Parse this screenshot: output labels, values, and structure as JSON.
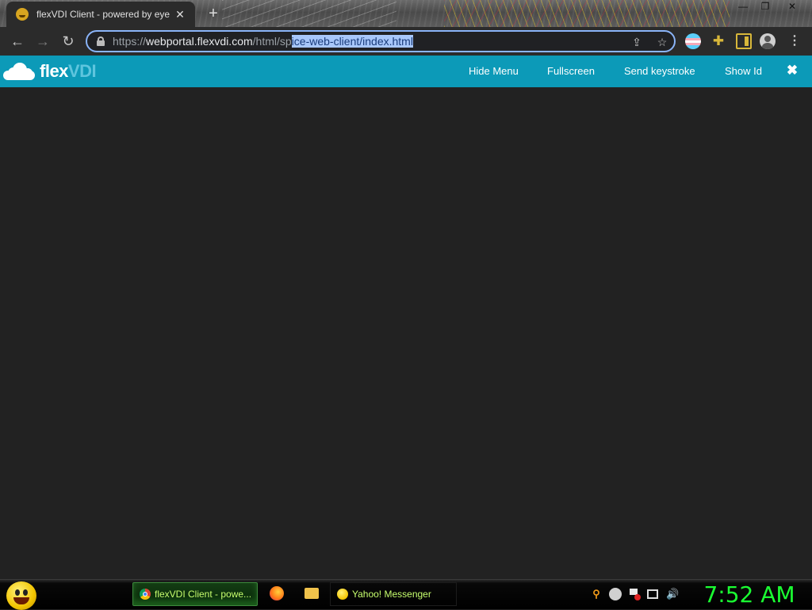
{
  "browser": {
    "tab_title": "flexVDI Client - powered by eye",
    "tab_close_glyph": "✕",
    "new_tab_glyph": "+",
    "window_controls": {
      "minimize": "—",
      "restore": "❐",
      "close": "✕"
    },
    "nav": {
      "back": "←",
      "forward": "→",
      "reload": "↻"
    },
    "url": {
      "scheme": "https://",
      "host": "webportal.flexvdi.com",
      "path_plain": "/html/sp",
      "path_selected": "ice-web-client/index.html"
    },
    "omnibox_icons": {
      "share": "⇪",
      "bookmark": "☆"
    },
    "extension_icons": [
      "profile-flag-icon",
      "puzzle-icon",
      "side-panel-icon",
      "account-avatar-icon",
      "kebab-menu-icon"
    ],
    "puzzle_glyph": "✚",
    "menu_glyph": "⋮"
  },
  "app": {
    "logo": {
      "part1": "flex",
      "part2": "VDI"
    },
    "menu": {
      "hide_menu": "Hide Menu",
      "fullscreen": "Fullscreen",
      "send_keystroke": "Send keystroke",
      "show_id": "Show Id"
    },
    "close_glyph": "✖",
    "colors": {
      "bar": "#0c9ab8",
      "canvas": "#222222"
    }
  },
  "taskbar": {
    "tasks": [
      {
        "label": "flexVDI Client - powe...",
        "icon": "chrome-icon",
        "active": true
      },
      {
        "label": "Yahoo! Messenger",
        "icon": "yahoo-messenger-icon",
        "active": false
      }
    ],
    "quick_launch": [
      "firefox-icon",
      "folder-icon"
    ],
    "tray_icons": [
      "search-icon",
      "messenger-status-icon",
      "action-center-flag-icon",
      "network-icon",
      "volume-icon"
    ],
    "tray_glyphs": {
      "search": "⚲",
      "volume": "🔊"
    },
    "clock": "7:52 AM",
    "colors": {
      "clock": "#1aff32",
      "task_text": "#c7ff6e"
    }
  }
}
